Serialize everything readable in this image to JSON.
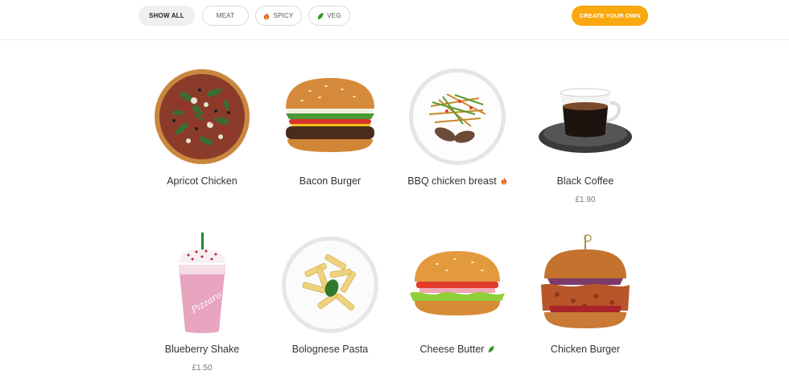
{
  "filters": {
    "show_all": "SHOW ALL",
    "meat": "MEAT",
    "spicy": "SPICY",
    "veg": "VEG"
  },
  "cta_label": "CREATE YOUR OWN",
  "colors": {
    "accent": "#f9a80f",
    "spicy": "#e4572e",
    "veg": "#3f9b2f"
  },
  "items": [
    {
      "name": "Apricot Chicken",
      "price": "",
      "icon": "pizza-image"
    },
    {
      "name": "Bacon Burger",
      "price": "",
      "icon": "burger-image"
    },
    {
      "name": "BBQ chicken breast",
      "price": "",
      "badge": "spicy",
      "icon": "salad-plate-image"
    },
    {
      "name": "Black Coffee",
      "price": "£1.90",
      "icon": "coffee-cup-image"
    },
    {
      "name": "Blueberry Shake",
      "price": "£1.50",
      "icon": "shake-cup-image"
    },
    {
      "name": "Bolognese Pasta",
      "price": "",
      "icon": "pasta-plate-image"
    },
    {
      "name": "Cheese Butter",
      "price": "",
      "badge": "veg",
      "icon": "burger-image"
    },
    {
      "name": "Chicken Burger",
      "price": "",
      "icon": "chicken-burger-image"
    }
  ]
}
